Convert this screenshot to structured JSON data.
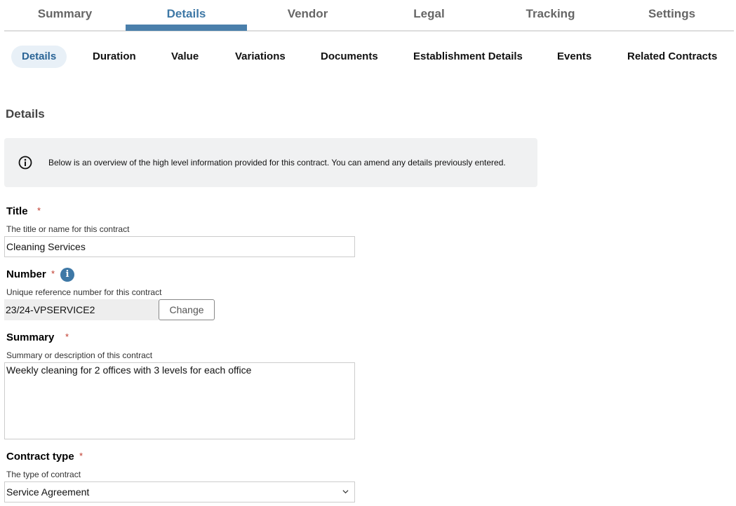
{
  "top_tabs": [
    "Summary",
    "Details",
    "Vendor",
    "Legal",
    "Tracking",
    "Settings"
  ],
  "sub_tabs": [
    "Details",
    "Duration",
    "Value",
    "Variations",
    "Documents",
    "Establishment Details",
    "Events",
    "Related Contracts"
  ],
  "section": {
    "title": "Details"
  },
  "info": {
    "text": "Below is an overview of the high level information provided for this contract. You can amend any details previously entered."
  },
  "fields": {
    "title": {
      "label": "Title",
      "required": "*",
      "hint": "The title or name for this contract",
      "value": "Cleaning Services"
    },
    "number": {
      "label": "Number",
      "required": "*",
      "hint": "Unique reference number for this contract",
      "value": "23/24-VPSERVICE2",
      "button": "Change"
    },
    "summary": {
      "label": "Summary",
      "required": "*",
      "hint": "Summary or description of this contract",
      "value": "Weekly cleaning for 2 offices with 3 levels for each office"
    },
    "contract_type": {
      "label": "Contract type",
      "required": "*",
      "hint": "The type of contract",
      "value": "Service Agreement"
    }
  },
  "icons": {
    "info": "info-circle-icon",
    "number_info": "info-icon",
    "select": "chevron-down-icon"
  },
  "colors": {
    "accent": "#3e78a6",
    "required": "#c0392b",
    "info_bg": "#f0f1f2"
  }
}
